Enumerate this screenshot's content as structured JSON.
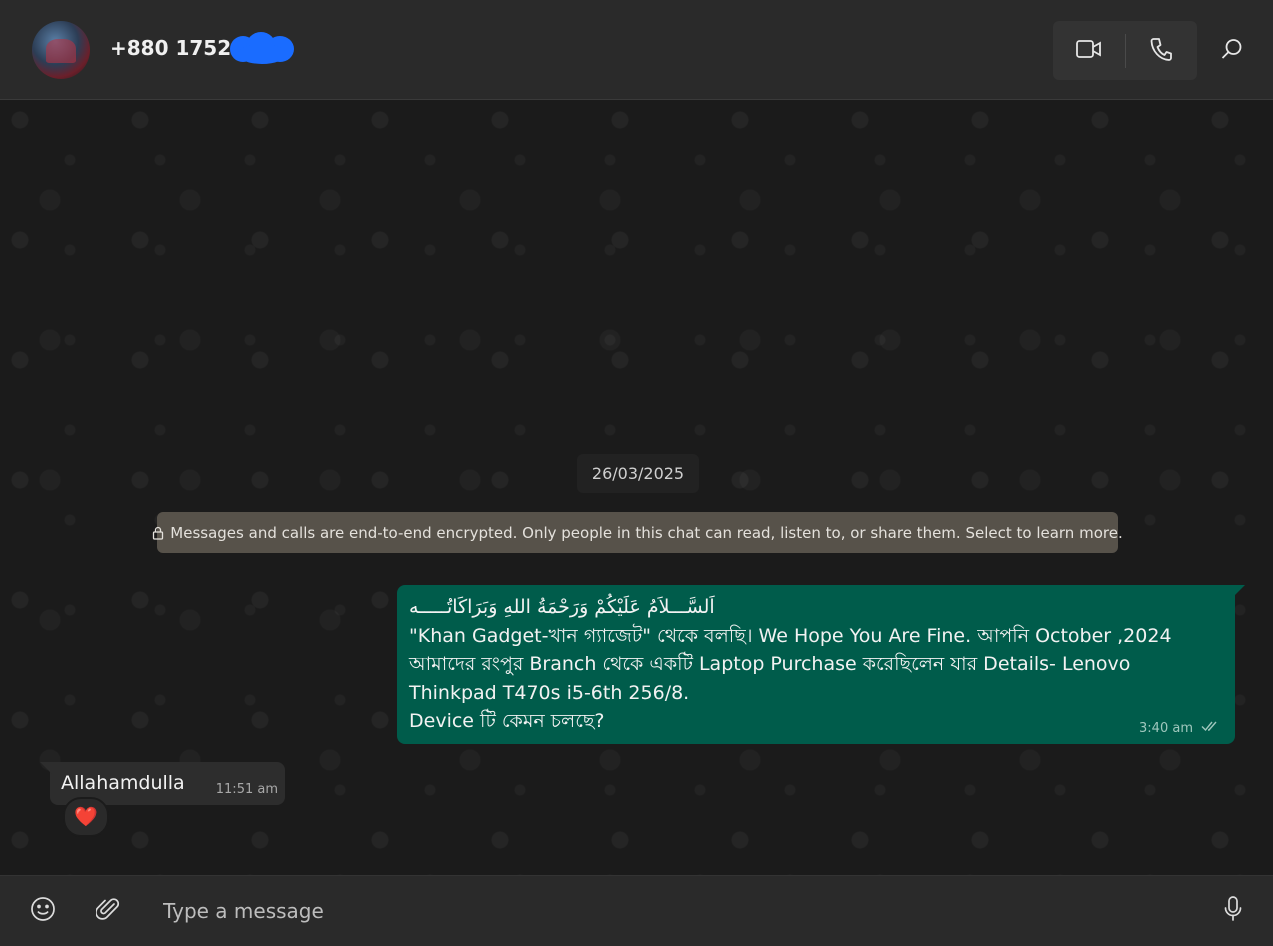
{
  "header": {
    "contact_name": "+880 1752-8",
    "video_call_icon": "video-camera-icon",
    "voice_call_icon": "phone-icon",
    "search_icon": "magnifier-icon"
  },
  "chat": {
    "date_chip": "26/03/2025",
    "encryption_notice": "Messages and calls are end-to-end encrypted. Only people in this chat can read, listen to, or share them. Select to learn more.",
    "outgoing": {
      "lines": [
        "اَلسَّـــلاَمُ عَلَيْكُمْ وَرَحْمَةُ اللهِ وَبَرَاكَاتُـــــه",
        " \"Khan Gadget-খান গ্যাজেট\" থেকে বলছি। We Hope You Are Fine. আপনি October ,2024",
        "আমাদের রংপুর Branch থেকে একটি Laptop Purchase করেছিলেন যার Details- Lenovo",
        "Thinkpad T470s i5-6th 256/8.",
        "Device টি কেমন চলছে?"
      ],
      "time": "3:40 am",
      "status_icon": "double-check-icon"
    },
    "incoming": {
      "text": "Allahamdulla",
      "time": "11:51 am",
      "reaction": "❤️"
    }
  },
  "composer": {
    "placeholder": "Type a message",
    "emoji_icon": "emoji-icon",
    "attach_icon": "paperclip-icon",
    "mic_icon": "microphone-icon"
  },
  "colors": {
    "outgoing_bubble": "#005c4b",
    "incoming_bubble": "#2d2d2d",
    "notice_bg": "#57524a",
    "header_bg": "#2a2a2a"
  }
}
